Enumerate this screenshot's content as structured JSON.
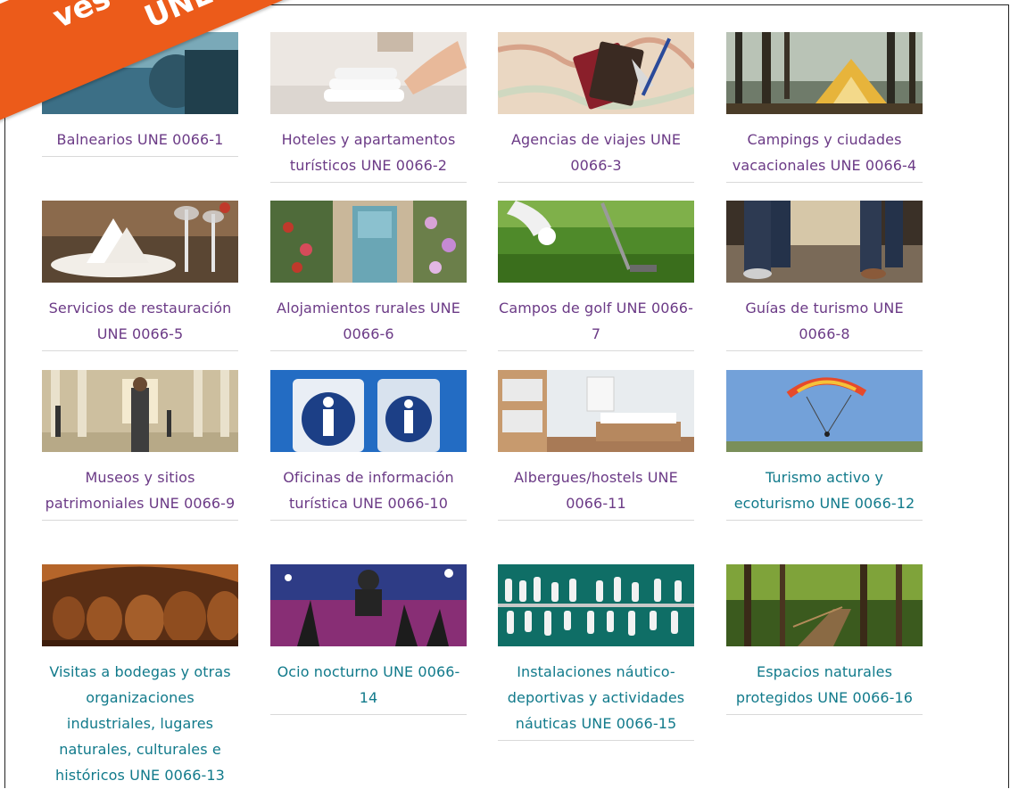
{
  "banner": {
    "line1": "ves especifica",
    "line2": "UNE"
  },
  "cards": [
    {
      "caption": "Balnearios UNE 0066-1",
      "color": "#6b3a86"
    },
    {
      "caption": "Hoteles y apartamentos turísticos UNE 0066-2",
      "color": "#6b3a86"
    },
    {
      "caption": "Agencias de viajes UNE 0066-3",
      "color": "#6b3a86"
    },
    {
      "caption": "Campings y ciudades vacacionales UNE 0066-4",
      "color": "#6b3a86"
    },
    {
      "caption": "Servicios de restauración UNE 0066-5",
      "color": "#6b3a86"
    },
    {
      "caption": "Alojamientos rurales UNE 0066-6",
      "color": "#6b3a86"
    },
    {
      "caption": "Campos de golf UNE 0066-7",
      "color": "#6b3a86"
    },
    {
      "caption": "Guías de turismo UNE 0066-8",
      "color": "#6b3a86"
    },
    {
      "caption": "Museos y sitios patrimoniales UNE 0066-9",
      "color": "#6b3a86"
    },
    {
      "caption": "Oficinas de información turística UNE 0066-10",
      "color": "#6b3a86"
    },
    {
      "caption": "Albergues/hostels UNE 0066-11",
      "color": "#6b3a86"
    },
    {
      "caption": "Turismo activo y ecoturismo UNE 0066-12",
      "color": "#117a8b"
    },
    {
      "caption": "Visitas a bodegas y otras organizaciones industriales, lugares naturales, culturales e históricos UNE 0066-13",
      "color": "#117a8b"
    },
    {
      "caption": "Ocio nocturno UNE 0066-14",
      "color": "#117a8b"
    },
    {
      "caption": "Instalaciones náutico-deportivas y actividades náuticas UNE 0066-15",
      "color": "#117a8b"
    },
    {
      "caption": "Espacios naturales protegidos UNE 0066-16",
      "color": "#117a8b"
    }
  ]
}
